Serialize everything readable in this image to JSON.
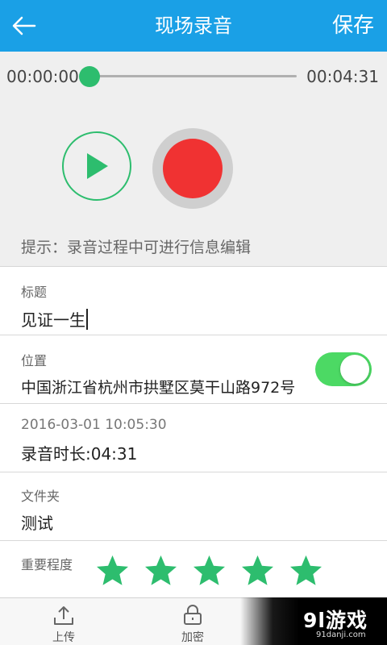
{
  "header": {
    "title": "现场录音",
    "save_label": "保存",
    "color": "#1aa0e6"
  },
  "player": {
    "current_time": "00:00:00",
    "total_time": "00:04:31",
    "progress": 0,
    "play_icon": "play-icon",
    "record_icon": "record-icon",
    "hint": "提示：录音过程中可进行信息编辑"
  },
  "form": {
    "title_label": "标题",
    "title_value": "见证一生",
    "location_label": "位置",
    "location_value": "中国浙江省杭州市拱墅区莫干山路972号",
    "location_enabled": true,
    "timestamp": "2016-03-01 10:05:30",
    "duration": "录音时长:04:31",
    "folder_label": "文件夹",
    "folder_value": "测试",
    "importance_label": "重要程度",
    "importance_stars": 5,
    "importance_max": 5
  },
  "bottom_bar": {
    "upload_label": "上传",
    "upload_icon": "upload-icon",
    "encrypt_label": "加密",
    "encrypt_icon": "lock-icon"
  },
  "watermark": {
    "logo_text": "9l游戏",
    "url": "91danji.com"
  },
  "colors": {
    "accent_green": "#2dbd6e",
    "record_red": "#f03232",
    "toggle_on": "#4cd964"
  }
}
